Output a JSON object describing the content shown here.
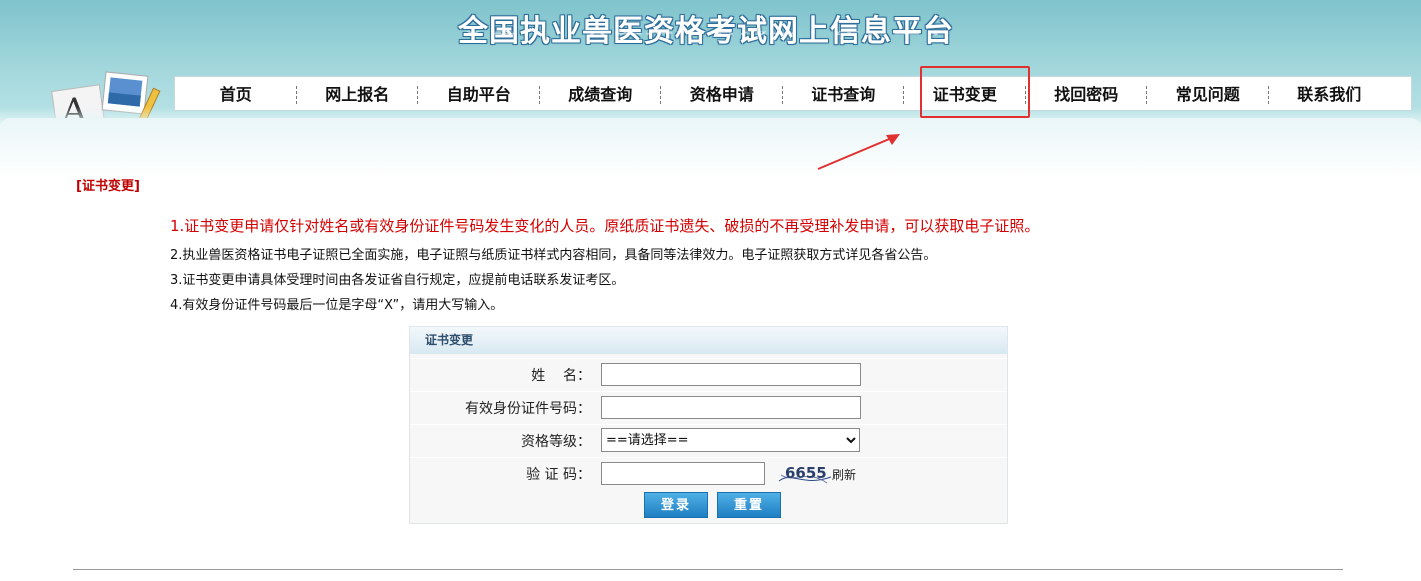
{
  "site": {
    "title": "全国执业兽医资格考试网上信息平台"
  },
  "nav": {
    "items": [
      "首页",
      "网上报名",
      "自助平台",
      "成绩查询",
      "资格申请",
      "证书查询",
      "证书变更",
      "找回密码",
      "常见问题",
      "联系我们"
    ],
    "active": "证书变更"
  },
  "section": {
    "title": "[证书变更]"
  },
  "notices": [
    "1.证书变更申请仅针对姓名或有效身份证件号码发生变化的人员。原纸质证书遗失、破损的不再受理补发申请，可以获取电子证照。",
    "2.执业兽医资格证书电子证照已全面实施，电子证照与纸质证书样式内容相同，具备同等法律效力。电子证照获取方式详见各省公告。",
    "3.证书变更申请具体受理时间由各发证省自行规定，应提前电话联系发证考区。",
    "4.有效身份证件号码最后一位是字母“X”，请用大写输入。"
  ],
  "form": {
    "header": "证书变更",
    "name_label": "姓    名：",
    "id_label": "有效身份证件号码：",
    "level_label": "资格等级：",
    "level_selected": "==请选择==",
    "captcha_label": "验 证 码：",
    "captcha_text": "6655",
    "refresh_label": "刷新",
    "login_button": "登录",
    "reset_button": "重置"
  },
  "colors": {
    "highlight_box": "#e03030",
    "notice_red": "#d40000"
  }
}
